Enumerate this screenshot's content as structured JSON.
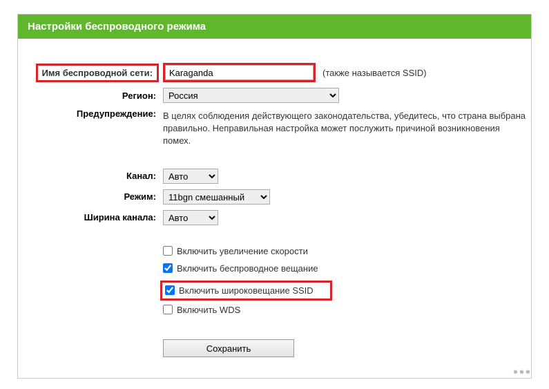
{
  "header": {
    "title": "Настройки беспроводного режима"
  },
  "fields": {
    "ssid": {
      "label": "Имя беспроводной сети:",
      "value": "Karaganda",
      "hint": "(также называется SSID)"
    },
    "region": {
      "label": "Регион:",
      "value": "Россия"
    },
    "warning": {
      "label": "Предупреждение:",
      "text": "В целях соблюдения действующего законодательства, убедитесь, что страна выбрана правильно. Неправильная настройка может послужить причиной возникновения помех."
    },
    "channel": {
      "label": "Канал:",
      "value": "Авто"
    },
    "mode": {
      "label": "Режим:",
      "value": "11bgn смешанный"
    },
    "channel_width": {
      "label": "Ширина канала:",
      "value": "Авто"
    }
  },
  "checkboxes": {
    "speed_boost": {
      "label": "Включить увеличение скорости",
      "checked": false
    },
    "wireless_broadcast": {
      "label": "Включить беспроводное вещание",
      "checked": true
    },
    "ssid_broadcast": {
      "label": "Включить широковещание SSID",
      "checked": true
    },
    "wds": {
      "label": "Включить WDS",
      "checked": false
    }
  },
  "buttons": {
    "save": "Сохранить"
  }
}
